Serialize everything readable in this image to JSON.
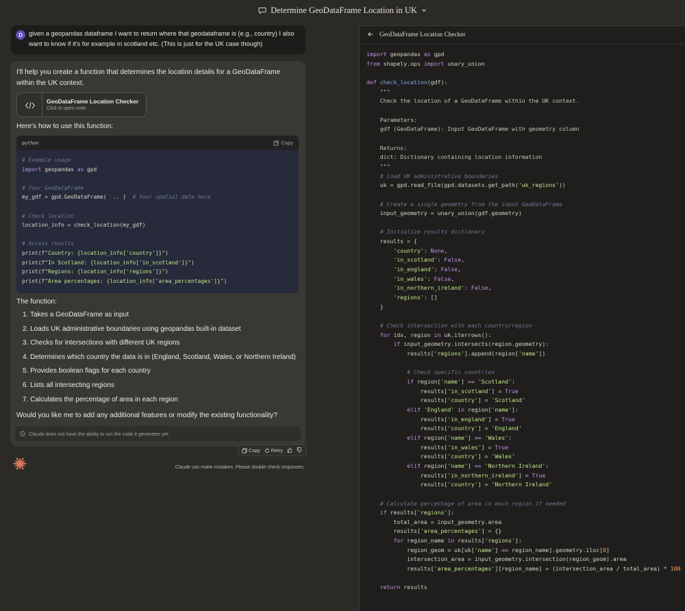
{
  "header": {
    "title": "Determine GeoDataFrame Location in UK"
  },
  "user_message": {
    "avatar_initial": "D",
    "text": "given a geopandas dataframe I want to return where that geodataframe is (e.g., country) I also want to know if it's for example in scotland etc. (This is just for the UK case though)"
  },
  "assistant": {
    "intro": "I'll help you create a function that determines the location details for a GeoDataFrame within the UK context.",
    "artifact_card": {
      "title": "GeoDataFrame Location Checker",
      "subtitle": "Click to open code"
    },
    "usage_label": "Here's how to use this function:",
    "code_block": {
      "language": "python",
      "copy_label": "Copy",
      "lines": [
        {
          "type": "comment",
          "text": "# Example usage"
        },
        {
          "type": "code",
          "text": "import geopandas as gpd"
        },
        {
          "type": "blank",
          "text": ""
        },
        {
          "type": "comment",
          "text": "# Your GeoDataFrame"
        },
        {
          "type": "code",
          "text": "my_gdf = gpd.GeoDataFrame(  .. )  # Your spatial data here"
        },
        {
          "type": "blank",
          "text": ""
        },
        {
          "type": "comment",
          "text": "# Check location"
        },
        {
          "type": "code",
          "text": "location_info = check_location(my_gdf)"
        },
        {
          "type": "blank",
          "text": ""
        },
        {
          "type": "comment",
          "text": "# Access results"
        },
        {
          "type": "code",
          "text": "print(f\"Country: {location_info['country']}\")"
        },
        {
          "type": "code",
          "text": "print(f\"In Scotland: {location_info['in_scotland']}\")"
        },
        {
          "type": "code",
          "text": "print(f\"Regions: {location_info['regions']}\")"
        },
        {
          "type": "code",
          "text": "print(f\"Area percentages: {location_info['area_percentages']}\")"
        }
      ]
    },
    "function_label": "The function:",
    "steps": [
      "1. Takes a GeoDataFrame as input",
      "2. Loads UK administrative boundaries using geopandas built-in dataset",
      "3. Checks for intersections with different UK regions",
      "4. Determines which country the data is in (England, Scotland, Wales, or Northern Ireland)",
      "5. Provides boolean flags for each country",
      "6. Lists all intersecting regions",
      "7. Calculates the percentage of area in each region"
    ],
    "outro": "Would you like me to add any additional features or modify the existing functionality?",
    "disclaimer": "Claude does not have the ability to run the code it generates yet.",
    "actions": {
      "copy": "Copy",
      "retry": "Retry"
    }
  },
  "footer_note": "Claude can make mistakes. Please double-check responses.",
  "panel": {
    "title": "GeoDataFrame Location Checker",
    "code": [
      "import geopandas as gpd",
      "from shapely.ops import unary_union",
      "",
      "def check_location(gdf):",
      "    \"\"\"",
      "    Check the location of a GeoDataFrame within the UK context.",
      "",
      "    Parameters:",
      "    gdf (GeoDataFrame): Input GeoDataFrame with geometry column",
      "",
      "    Returns:",
      "    dict: Dictionary containing location information",
      "    \"\"\"",
      "    # Load UK administrative boundaries",
      "    uk = gpd.read_file(gpd.datasets.get_path('uk_regions'))",
      "",
      "    # Create a single geometry from the input GeoDataFrame",
      "    input_geometry = unary_union(gdf.geometry)",
      "",
      "    # Initialize results dictionary",
      "    results = {",
      "        'country': None,",
      "        'in_scotland': False,",
      "        'in_england': False,",
      "        'in_wales': False,",
      "        'in_northern_ireland': False,",
      "        'regions': []",
      "    }",
      "",
      "    # Check intersection with each country/region",
      "    for idx, region in uk.iterrows():",
      "        if input_geometry.intersects(region.geometry):",
      "            results['regions'].append(region['name'])",
      "",
      "            # Check specific countries",
      "            if region['name'] == 'Scotland':",
      "                results['in_scotland'] = True",
      "                results['country'] = 'Scotland'",
      "            elif 'England' in region['name']:",
      "                results['in_england'] = True",
      "                results['country'] = 'England'",
      "            elif region['name'] == 'Wales':",
      "                results['in_wales'] = True",
      "                results['country'] = 'Wales'",
      "            elif region['name'] == 'Northern Ireland':",
      "                results['in_northern_ireland'] = True",
      "                results['country'] = 'Northern Ireland'",
      "",
      "    # Calculate percentage of area in each region if needed",
      "    if results['regions']:",
      "        total_area = input_geometry.area",
      "        results['area_percentages'] = {}",
      "        for region_name in results['regions']:",
      "            region_geom = uk[uk['name'] == region_name].geometry.iloc[0]",
      "            intersection_area = input_geometry.intersection(region_geom).area",
      "            results['area_percentages'][region_name] = (intersection_area / total_area) * 100",
      "",
      "    return results"
    ]
  },
  "colors": {
    "accent_spark": "#d97757",
    "avatar": "#5f4fb3",
    "code_bg": "#262a3a",
    "panel_bg": "#1f1e1c"
  }
}
